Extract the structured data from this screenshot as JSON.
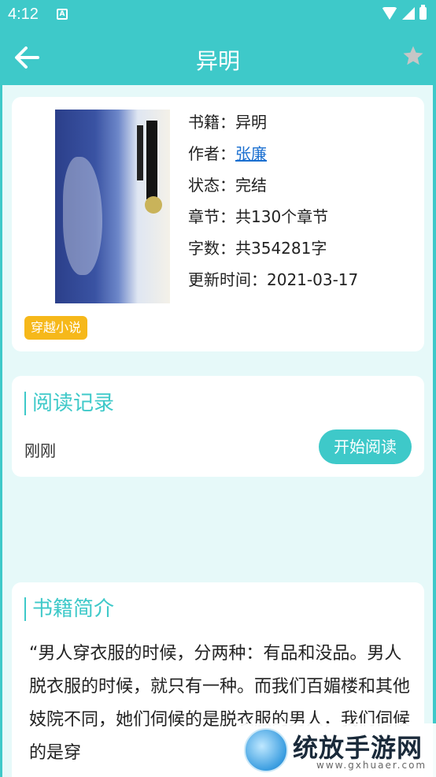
{
  "status_bar": {
    "time": "4:12",
    "notif_letter": "A"
  },
  "app_bar": {
    "title": "异明"
  },
  "book": {
    "rows": [
      {
        "label": "书籍：",
        "value": "异明"
      },
      {
        "label": "作者：",
        "value": "张廉"
      },
      {
        "label": "状态：",
        "value": "完结"
      },
      {
        "label": "章节：",
        "value": "共130个章节"
      },
      {
        "label": "字数：",
        "value": "共354281字"
      },
      {
        "label": "更新时间：",
        "value": "2021-03-17"
      }
    ],
    "tag": "穿越小说"
  },
  "reading": {
    "title": "阅读记录",
    "status": "刚刚",
    "start_button": "开始阅读"
  },
  "intro": {
    "title": "书籍简介",
    "text": "“男人穿衣服的时候，分两种：有品和没品。男人脱衣服的时候，就只有一种。而我们百媚楼和其他妓院不同，她们伺候的是脱衣服的男人，我们伺候的是穿"
  },
  "watermark": {
    "text": "统放手游网",
    "url": "www.gxhuaer.com"
  },
  "colors": {
    "accent": "#3ec9c9",
    "tag": "#f6b81a",
    "link": "#1a6fd0",
    "background": "#e6f9f9"
  }
}
